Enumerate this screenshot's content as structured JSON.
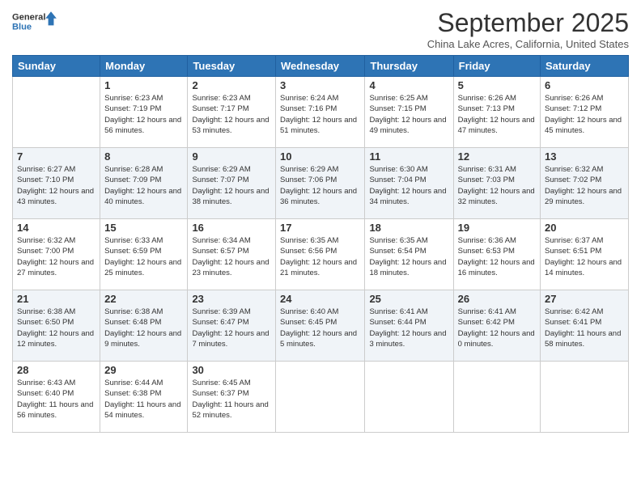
{
  "header": {
    "logo_line1": "General",
    "logo_line2": "Blue",
    "month": "September 2025",
    "location": "China Lake Acres, California, United States"
  },
  "weekdays": [
    "Sunday",
    "Monday",
    "Tuesday",
    "Wednesday",
    "Thursday",
    "Friday",
    "Saturday"
  ],
  "weeks": [
    [
      {
        "day": "",
        "sunrise": "",
        "sunset": "",
        "daylight": ""
      },
      {
        "day": "1",
        "sunrise": "Sunrise: 6:23 AM",
        "sunset": "Sunset: 7:19 PM",
        "daylight": "Daylight: 12 hours and 56 minutes."
      },
      {
        "day": "2",
        "sunrise": "Sunrise: 6:23 AM",
        "sunset": "Sunset: 7:17 PM",
        "daylight": "Daylight: 12 hours and 53 minutes."
      },
      {
        "day": "3",
        "sunrise": "Sunrise: 6:24 AM",
        "sunset": "Sunset: 7:16 PM",
        "daylight": "Daylight: 12 hours and 51 minutes."
      },
      {
        "day": "4",
        "sunrise": "Sunrise: 6:25 AM",
        "sunset": "Sunset: 7:15 PM",
        "daylight": "Daylight: 12 hours and 49 minutes."
      },
      {
        "day": "5",
        "sunrise": "Sunrise: 6:26 AM",
        "sunset": "Sunset: 7:13 PM",
        "daylight": "Daylight: 12 hours and 47 minutes."
      },
      {
        "day": "6",
        "sunrise": "Sunrise: 6:26 AM",
        "sunset": "Sunset: 7:12 PM",
        "daylight": "Daylight: 12 hours and 45 minutes."
      }
    ],
    [
      {
        "day": "7",
        "sunrise": "Sunrise: 6:27 AM",
        "sunset": "Sunset: 7:10 PM",
        "daylight": "Daylight: 12 hours and 43 minutes."
      },
      {
        "day": "8",
        "sunrise": "Sunrise: 6:28 AM",
        "sunset": "Sunset: 7:09 PM",
        "daylight": "Daylight: 12 hours and 40 minutes."
      },
      {
        "day": "9",
        "sunrise": "Sunrise: 6:29 AM",
        "sunset": "Sunset: 7:07 PM",
        "daylight": "Daylight: 12 hours and 38 minutes."
      },
      {
        "day": "10",
        "sunrise": "Sunrise: 6:29 AM",
        "sunset": "Sunset: 7:06 PM",
        "daylight": "Daylight: 12 hours and 36 minutes."
      },
      {
        "day": "11",
        "sunrise": "Sunrise: 6:30 AM",
        "sunset": "Sunset: 7:04 PM",
        "daylight": "Daylight: 12 hours and 34 minutes."
      },
      {
        "day": "12",
        "sunrise": "Sunrise: 6:31 AM",
        "sunset": "Sunset: 7:03 PM",
        "daylight": "Daylight: 12 hours and 32 minutes."
      },
      {
        "day": "13",
        "sunrise": "Sunrise: 6:32 AM",
        "sunset": "Sunset: 7:02 PM",
        "daylight": "Daylight: 12 hours and 29 minutes."
      }
    ],
    [
      {
        "day": "14",
        "sunrise": "Sunrise: 6:32 AM",
        "sunset": "Sunset: 7:00 PM",
        "daylight": "Daylight: 12 hours and 27 minutes."
      },
      {
        "day": "15",
        "sunrise": "Sunrise: 6:33 AM",
        "sunset": "Sunset: 6:59 PM",
        "daylight": "Daylight: 12 hours and 25 minutes."
      },
      {
        "day": "16",
        "sunrise": "Sunrise: 6:34 AM",
        "sunset": "Sunset: 6:57 PM",
        "daylight": "Daylight: 12 hours and 23 minutes."
      },
      {
        "day": "17",
        "sunrise": "Sunrise: 6:35 AM",
        "sunset": "Sunset: 6:56 PM",
        "daylight": "Daylight: 12 hours and 21 minutes."
      },
      {
        "day": "18",
        "sunrise": "Sunrise: 6:35 AM",
        "sunset": "Sunset: 6:54 PM",
        "daylight": "Daylight: 12 hours and 18 minutes."
      },
      {
        "day": "19",
        "sunrise": "Sunrise: 6:36 AM",
        "sunset": "Sunset: 6:53 PM",
        "daylight": "Daylight: 12 hours and 16 minutes."
      },
      {
        "day": "20",
        "sunrise": "Sunrise: 6:37 AM",
        "sunset": "Sunset: 6:51 PM",
        "daylight": "Daylight: 12 hours and 14 minutes."
      }
    ],
    [
      {
        "day": "21",
        "sunrise": "Sunrise: 6:38 AM",
        "sunset": "Sunset: 6:50 PM",
        "daylight": "Daylight: 12 hours and 12 minutes."
      },
      {
        "day": "22",
        "sunrise": "Sunrise: 6:38 AM",
        "sunset": "Sunset: 6:48 PM",
        "daylight": "Daylight: 12 hours and 9 minutes."
      },
      {
        "day": "23",
        "sunrise": "Sunrise: 6:39 AM",
        "sunset": "Sunset: 6:47 PM",
        "daylight": "Daylight: 12 hours and 7 minutes."
      },
      {
        "day": "24",
        "sunrise": "Sunrise: 6:40 AM",
        "sunset": "Sunset: 6:45 PM",
        "daylight": "Daylight: 12 hours and 5 minutes."
      },
      {
        "day": "25",
        "sunrise": "Sunrise: 6:41 AM",
        "sunset": "Sunset: 6:44 PM",
        "daylight": "Daylight: 12 hours and 3 minutes."
      },
      {
        "day": "26",
        "sunrise": "Sunrise: 6:41 AM",
        "sunset": "Sunset: 6:42 PM",
        "daylight": "Daylight: 12 hours and 0 minutes."
      },
      {
        "day": "27",
        "sunrise": "Sunrise: 6:42 AM",
        "sunset": "Sunset: 6:41 PM",
        "daylight": "Daylight: 11 hours and 58 minutes."
      }
    ],
    [
      {
        "day": "28",
        "sunrise": "Sunrise: 6:43 AM",
        "sunset": "Sunset: 6:40 PM",
        "daylight": "Daylight: 11 hours and 56 minutes."
      },
      {
        "day": "29",
        "sunrise": "Sunrise: 6:44 AM",
        "sunset": "Sunset: 6:38 PM",
        "daylight": "Daylight: 11 hours and 54 minutes."
      },
      {
        "day": "30",
        "sunrise": "Sunrise: 6:45 AM",
        "sunset": "Sunset: 6:37 PM",
        "daylight": "Daylight: 11 hours and 52 minutes."
      },
      {
        "day": "",
        "sunrise": "",
        "sunset": "",
        "daylight": ""
      },
      {
        "day": "",
        "sunrise": "",
        "sunset": "",
        "daylight": ""
      },
      {
        "day": "",
        "sunrise": "",
        "sunset": "",
        "daylight": ""
      },
      {
        "day": "",
        "sunrise": "",
        "sunset": "",
        "daylight": ""
      }
    ]
  ]
}
